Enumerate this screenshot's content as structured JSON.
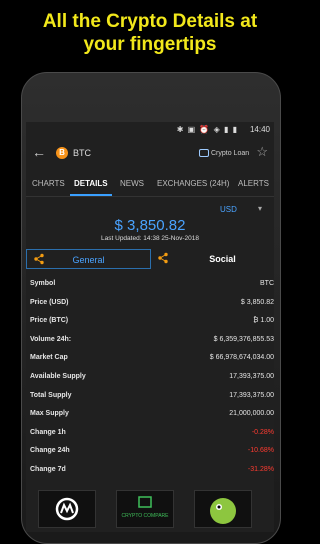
{
  "headline": {
    "line1": "All the Crypto Details at",
    "line2": "your fingertips"
  },
  "statusbar": {
    "time": "14:40",
    "icons": [
      "bluetooth-icon",
      "nfc-icon",
      "alarm-icon",
      "wifi-icon",
      "signal-icon",
      "battery-icon"
    ]
  },
  "appbar": {
    "coin_letter": "B",
    "symbol": "BTC",
    "loan_label": "Crypto Loan"
  },
  "tabs": [
    "CHARTS",
    "DETAILS",
    "NEWS",
    "EXCHANGES (24H)",
    "ALERTS"
  ],
  "active_tab": "DETAILS",
  "currency": "USD",
  "price": "$ 3,850.82",
  "last_updated": "Last Updated: 14:38 25-Nov-2018",
  "segments": {
    "general": "General",
    "social": "Social"
  },
  "details": [
    {
      "label": "Symbol",
      "value": "BTC",
      "negative": false
    },
    {
      "label": "Price (USD)",
      "value": "$ 3,850.82",
      "negative": false
    },
    {
      "label": "Price (BTC)",
      "value": "₿ 1.00",
      "negative": false
    },
    {
      "label": "Volume 24h:",
      "value": "$ 6,359,376,855.53",
      "negative": false
    },
    {
      "label": "Market Cap",
      "value": "$ 66,978,674,034.00",
      "negative": false
    },
    {
      "label": "Available Supply",
      "value": "17,393,375.00",
      "negative": false
    },
    {
      "label": "Total Supply",
      "value": "17,393,375.00",
      "negative": false
    },
    {
      "label": "Max Supply",
      "value": "21,000,000.00",
      "negative": false
    },
    {
      "label": "Change 1h",
      "value": "-0.28%",
      "negative": true
    },
    {
      "label": "Change 24h",
      "value": "-10.68%",
      "negative": true
    },
    {
      "label": "Change 7d",
      "value": "-31.28%",
      "negative": true
    }
  ],
  "promos": [
    {
      "name": "coinmarketcap-logo"
    },
    {
      "name": "cryptocompare-logo",
      "text": "CRYPTO COMPARE"
    },
    {
      "name": "coingecko-logo"
    }
  ],
  "colors": {
    "accent": "#4aa3ff",
    "headline": "#f2e81b",
    "negative": "#ff3b30",
    "share": "#f39c12"
  }
}
